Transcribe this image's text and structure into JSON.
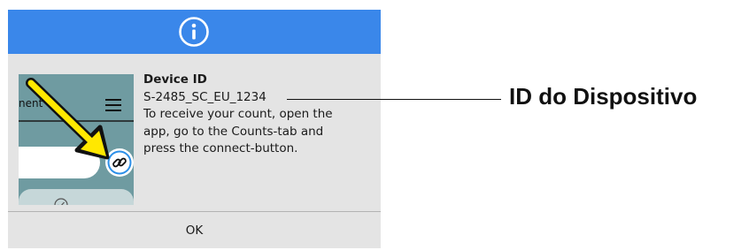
{
  "dialog": {
    "header_icon": "info-icon",
    "thumbnail": {
      "partial_label": "nent",
      "menu_icon": "hamburger-menu-icon",
      "connect_icon": "link-icon",
      "pointer_icon": "yellow-arrow-icon",
      "check_icon": "checkmark-icon"
    },
    "title": "Device ID",
    "device_id": "S-2485_SC_EU_1234",
    "instructions": [
      "To receive your count, open the",
      "app, go to the Counts-tab and",
      "press the connect-button."
    ],
    "ok_label": "OK"
  },
  "annotation": {
    "label": "ID do Dispositivo"
  },
  "colors": {
    "header": "#3a87ea",
    "dialog_bg": "#e4e4e4",
    "thumb_bg": "#6f9ba1",
    "arrow": "#ffe800",
    "connect_button": "#2b8fe8"
  }
}
